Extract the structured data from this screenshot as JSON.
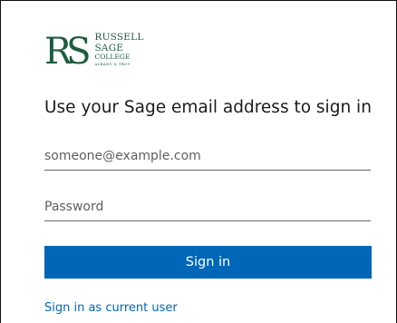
{
  "brand": {
    "monogram": "RS",
    "line1": "RUSSELL",
    "line2": "SAGE",
    "line3": "COLLEGE",
    "line4": "ALBANY & TROY",
    "color": "#1e5c3f"
  },
  "heading": "Use your Sage email address to sign in",
  "email_field": {
    "placeholder": "someone@example.com",
    "value": ""
  },
  "password_field": {
    "placeholder": "Password",
    "value": ""
  },
  "signin_button": {
    "label": "Sign in",
    "color": "#0067b8"
  },
  "current_user_link": "Sign in as current user"
}
